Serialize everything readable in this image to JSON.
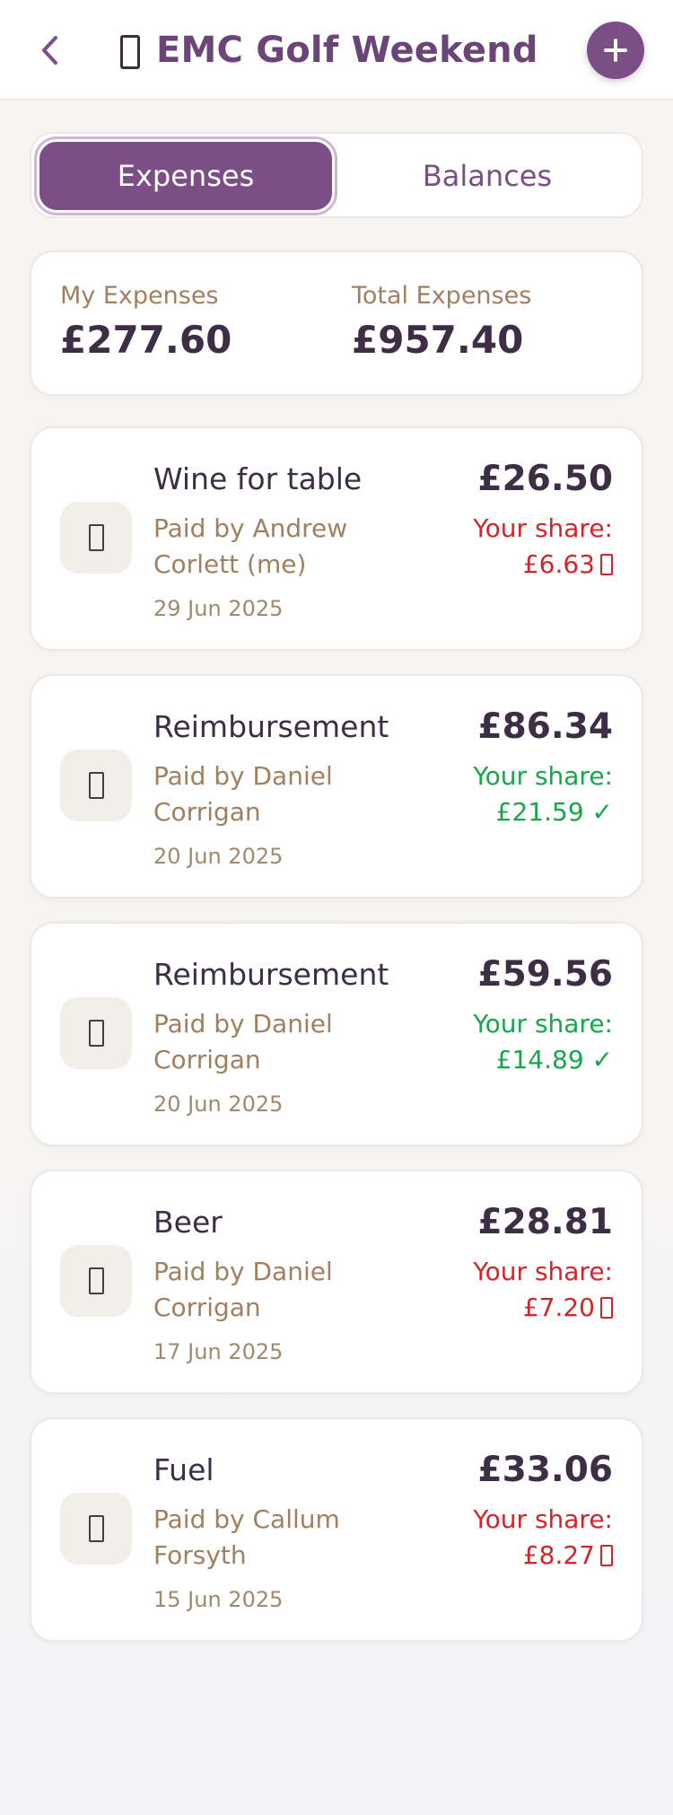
{
  "header": {
    "title": "EMC Golf Weekend",
    "title_icon": "golf-emoji-icon",
    "back_icon": "chevron-left-icon",
    "add_icon": "plus-icon"
  },
  "tabs": {
    "expenses": "Expenses",
    "balances": "Balances",
    "active": "Expenses"
  },
  "summary": {
    "my_label": "My Expenses",
    "my_value": "£277.60",
    "total_label": "Total Expenses",
    "total_value": "£957.40"
  },
  "expenses": [
    {
      "title": "Wine for table",
      "paid_by": "Paid by Andrew Corlett (me)",
      "date": "29 Jun 2025",
      "amount": "£26.50",
      "share_label": "Your share:",
      "share_value": "£6.63",
      "share_status": "owed",
      "icon": "wine-emoji-icon"
    },
    {
      "title": "Reimbursement",
      "paid_by": "Paid by Daniel Corrigan",
      "date": "20 Jun 2025",
      "amount": "£86.34",
      "share_label": "Your share:",
      "share_value": "£21.59 ✓",
      "share_status": "settled",
      "icon": "money-emoji-icon"
    },
    {
      "title": "Reimbursement",
      "paid_by": "Paid by Daniel Corrigan",
      "date": "20 Jun 2025",
      "amount": "£59.56",
      "share_label": "Your share:",
      "share_value": "£14.89 ✓",
      "share_status": "settled",
      "icon": "money-emoji-icon"
    },
    {
      "title": "Beer",
      "paid_by": "Paid by Daniel Corrigan",
      "date": "17 Jun 2025",
      "amount": "£28.81",
      "share_label": "Your share:",
      "share_value": "£7.20",
      "share_status": "owed",
      "icon": "beer-emoji-icon"
    },
    {
      "title": "Fuel",
      "paid_by": "Paid by Callum Forsyth",
      "date": "15 Jun 2025",
      "amount": "£33.06",
      "share_label": "Your share:",
      "share_value": "£8.27",
      "share_status": "owed",
      "icon": "fuel-emoji-icon"
    }
  ],
  "colors": {
    "accent": "#7b4f86",
    "title": "#6b4577",
    "text_dark": "#3d2d45",
    "text_muted": "#a08060",
    "share_owed": "#d0262b",
    "share_settled": "#17a64a"
  }
}
